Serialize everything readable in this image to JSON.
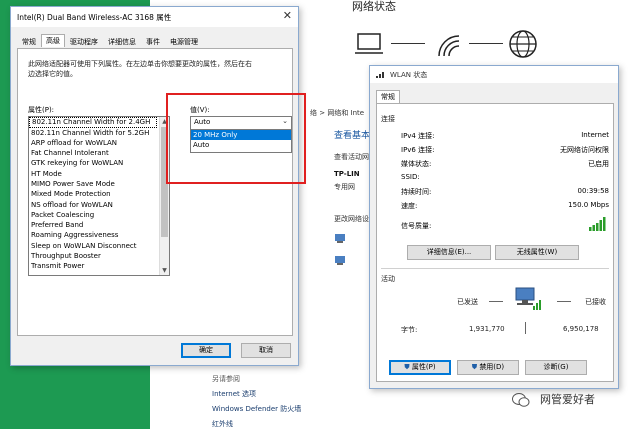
{
  "background": {
    "status_title": "网络状态",
    "breadcrumb": "网络和 Inte",
    "breadcrumb_prefix": "络",
    "heading": "查看基本",
    "sub": "查看活动网",
    "tplink": "TP-LIN",
    "tpsub": "专用网",
    "change": "更改网络设",
    "see_also": "另请参阅",
    "see_links": [
      "Internet 选项",
      "Windows Defender 防火墙",
      "红外线"
    ]
  },
  "dialog": {
    "title": "Intel(R) Dual Band Wireless-AC 3168 属性",
    "close": "✕",
    "tabs": [
      "常规",
      "高级",
      "驱动程序",
      "详细信息",
      "事件",
      "电源管理"
    ],
    "active_tab": 1,
    "description": "此网络适配器可使用下列属性。在左边单击你想要更改的属性，然后在右边选择它的值。",
    "property_label": "属性(P):",
    "properties": [
      "802.11n Channel Width for 2.4GH",
      "802.11n Channel Width for 5.2GH",
      "ARP offload for WoWLAN",
      "Fat Channel Intolerant",
      "GTK rekeying for WoWLAN",
      "HT Mode",
      "MIMO Power Save Mode",
      "Mixed Mode Protection",
      "NS offload for WoWLAN",
      "Packet Coalescing",
      "Preferred Band",
      "Roaming Aggressiveness",
      "Sleep on WoWLAN Disconnect",
      "Throughput Booster",
      "Transmit Power"
    ],
    "selected_property": 0,
    "value_label": "值(V):",
    "value": "Auto",
    "options": [
      "20 MHz Only",
      "Auto"
    ],
    "highlighted_option": 0,
    "ok": "确定",
    "cancel": "取消"
  },
  "wlan": {
    "title": "WLAN 状态",
    "tab": "常规",
    "connection_group": "连接",
    "rows": [
      {
        "k": "IPv4 连接:",
        "v": "Internet"
      },
      {
        "k": "IPv6 连接:",
        "v": "无网络访问权限"
      },
      {
        "k": "媒体状态:",
        "v": "已启用"
      },
      {
        "k": "SSID:",
        "v": ""
      },
      {
        "k": "持续时间:",
        "v": "00:39:58"
      },
      {
        "k": "速度:",
        "v": "150.0 Mbps"
      }
    ],
    "signal_label": "信号质量:",
    "signal_bars": 5,
    "details_btn": "详细信息(E)...",
    "wireless_btn": "无线属性(W)",
    "activity_group": "活动",
    "sent_label": "已发送",
    "received_label": "已接收",
    "bytes_label": "字节:",
    "bytes_sent": "1,931,770",
    "bytes_received": "6,950,178",
    "properties_btn": "属性(P)",
    "disable_btn": "禁用(D)",
    "diagnose_btn": "诊断(G)"
  },
  "watermark": "网管爱好者",
  "colors": {
    "accent": "#0078d7",
    "highlight_box": "#e02020",
    "green_bg": "#1d9a52"
  }
}
